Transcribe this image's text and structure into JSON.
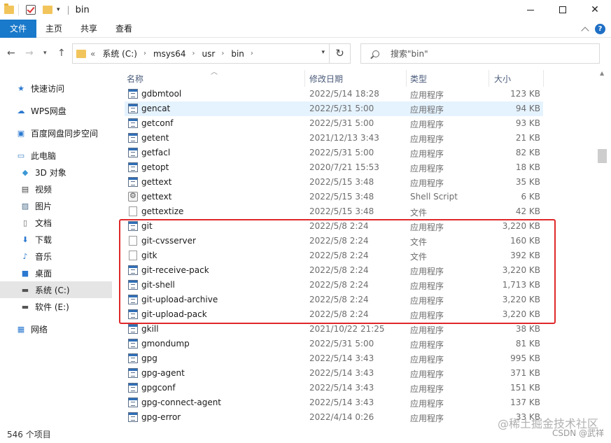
{
  "window": {
    "title": "bin"
  },
  "ribbon": {
    "tabs": [
      "文件",
      "主页",
      "共享",
      "查看"
    ]
  },
  "address": {
    "crumbs": [
      "系统 (C:)",
      "msys64",
      "usr",
      "bin"
    ],
    "prefix": "«"
  },
  "search": {
    "placeholder": "搜索\"bin\""
  },
  "sidebar": {
    "items": [
      {
        "label": "快速访问",
        "icon": "star-icon"
      },
      {
        "label": "WPS网盘",
        "icon": "cloud-icon"
      },
      {
        "label": "百度网盘同步空间",
        "icon": "sync-folder-icon"
      },
      {
        "label": "此电脑",
        "icon": "computer-icon"
      },
      {
        "label": "3D 对象",
        "icon": "cube-icon"
      },
      {
        "label": "视频",
        "icon": "video-icon"
      },
      {
        "label": "图片",
        "icon": "picture-icon"
      },
      {
        "label": "文档",
        "icon": "document-icon"
      },
      {
        "label": "下载",
        "icon": "download-icon"
      },
      {
        "label": "音乐",
        "icon": "music-icon"
      },
      {
        "label": "桌面",
        "icon": "desktop-icon"
      },
      {
        "label": "系统 (C:)",
        "icon": "drive-icon"
      },
      {
        "label": "软件 (E:)",
        "icon": "drive-icon"
      },
      {
        "label": "网络",
        "icon": "network-icon"
      }
    ]
  },
  "columns": {
    "name": "名称",
    "date": "修改日期",
    "type": "类型",
    "size": "大小"
  },
  "files": [
    {
      "name": "gdbmtool",
      "date": "2022/5/14 18:28",
      "type": "应用程序",
      "size": "123 KB",
      "icon": "exe"
    },
    {
      "name": "gencat",
      "date": "2022/5/31 5:00",
      "type": "应用程序",
      "size": "94 KB",
      "icon": "exe"
    },
    {
      "name": "getconf",
      "date": "2022/5/31 5:00",
      "type": "应用程序",
      "size": "93 KB",
      "icon": "exe"
    },
    {
      "name": "getent",
      "date": "2021/12/13 3:43",
      "type": "应用程序",
      "size": "21 KB",
      "icon": "exe"
    },
    {
      "name": "getfacl",
      "date": "2022/5/31 5:00",
      "type": "应用程序",
      "size": "82 KB",
      "icon": "exe"
    },
    {
      "name": "getopt",
      "date": "2020/7/21 15:53",
      "type": "应用程序",
      "size": "18 KB",
      "icon": "exe"
    },
    {
      "name": "gettext",
      "date": "2022/5/15 3:48",
      "type": "应用程序",
      "size": "35 KB",
      "icon": "exe"
    },
    {
      "name": "gettext",
      "date": "2022/5/15 3:48",
      "type": "Shell Script",
      "size": "6 KB",
      "icon": "script"
    },
    {
      "name": "gettextize",
      "date": "2022/5/15 3:48",
      "type": "文件",
      "size": "42 KB",
      "icon": "file"
    },
    {
      "name": "git",
      "date": "2022/5/8 2:24",
      "type": "应用程序",
      "size": "3,220 KB",
      "icon": "exe"
    },
    {
      "name": "git-cvsserver",
      "date": "2022/5/8 2:24",
      "type": "文件",
      "size": "160 KB",
      "icon": "file"
    },
    {
      "name": "gitk",
      "date": "2022/5/8 2:24",
      "type": "文件",
      "size": "392 KB",
      "icon": "file"
    },
    {
      "name": "git-receive-pack",
      "date": "2022/5/8 2:24",
      "type": "应用程序",
      "size": "3,220 KB",
      "icon": "exe"
    },
    {
      "name": "git-shell",
      "date": "2022/5/8 2:24",
      "type": "应用程序",
      "size": "1,713 KB",
      "icon": "exe"
    },
    {
      "name": "git-upload-archive",
      "date": "2022/5/8 2:24",
      "type": "应用程序",
      "size": "3,220 KB",
      "icon": "exe"
    },
    {
      "name": "git-upload-pack",
      "date": "2022/5/8 2:24",
      "type": "应用程序",
      "size": "3,220 KB",
      "icon": "exe"
    },
    {
      "name": "gkill",
      "date": "2021/10/22 21:25",
      "type": "应用程序",
      "size": "38 KB",
      "icon": "exe"
    },
    {
      "name": "gmondump",
      "date": "2022/5/31 5:00",
      "type": "应用程序",
      "size": "81 KB",
      "icon": "exe"
    },
    {
      "name": "gpg",
      "date": "2022/5/14 3:43",
      "type": "应用程序",
      "size": "995 KB",
      "icon": "exe"
    },
    {
      "name": "gpg-agent",
      "date": "2022/5/14 3:43",
      "type": "应用程序",
      "size": "371 KB",
      "icon": "exe"
    },
    {
      "name": "gpgconf",
      "date": "2022/5/14 3:43",
      "type": "应用程序",
      "size": "151 KB",
      "icon": "exe"
    },
    {
      "name": "gpg-connect-agent",
      "date": "2022/5/14 3:43",
      "type": "应用程序",
      "size": "137 KB",
      "icon": "exe"
    },
    {
      "name": "gpg-error",
      "date": "2022/4/14 0:26",
      "type": "应用程序",
      "size": "33 KB",
      "icon": "exe"
    }
  ],
  "status": {
    "count": "546 个项目"
  },
  "watermark": {
    "line1": "@稀土掘金技术社区",
    "line2": "CSDN @武祥"
  },
  "colors": {
    "accent": "#1979ca",
    "highlight_box": "#e0282a",
    "selected_row": "#e5f3ff"
  }
}
